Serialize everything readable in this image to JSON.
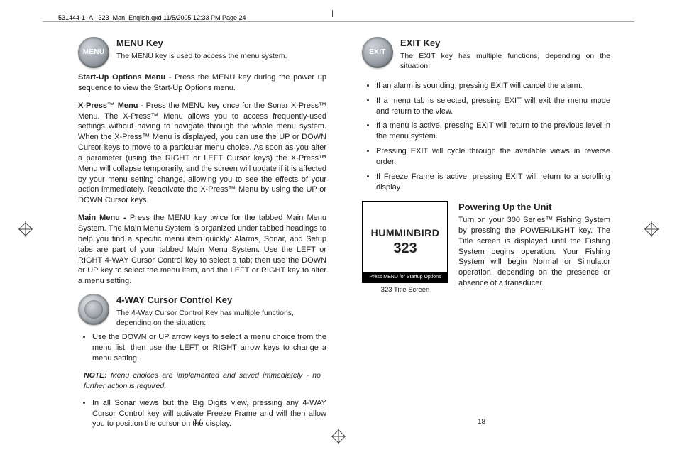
{
  "print_header": "531444-1_A - 323_Man_English.qxd  11/5/2005  12:33 PM  Page 24",
  "left": {
    "menu_key": {
      "icon_label": "MENU",
      "heading": "MENU Key",
      "sub": "The MENU key is used to access the menu system."
    },
    "startup_para_lead": "Start-Up Options Menu",
    "startup_para_rest": " - Press the MENU key during the power up sequence to view the Start-Up Options menu.",
    "xpress_para_lead": "X-Press™ Menu",
    "xpress_para_rest": " -  Press the MENU key once for the Sonar X-Press™ Menu. The X-Press™ Menu allows you to access frequently-used settings without having to navigate through the whole menu system. When the X-Press™ Menu is displayed, you can use the UP or DOWN Cursor keys to move to a particular menu choice. As soon as you alter a parameter (using the RIGHT or LEFT Cursor keys) the X-Press™ Menu will collapse temporarily, and the screen will update if it is affected by your menu setting change, allowing you to see the effects of your action immediately. Reactivate the X-Press™ Menu by using the UP or DOWN Cursor keys.",
    "main_para_lead": "Main Menu - ",
    "main_para_rest": "Press the MENU key twice for the tabbed Main Menu System. The Main Menu System is organized under tabbed headings to help you find a specific menu item quickly: Alarms, Sonar, and Setup tabs are part of your tabbed Main Menu System. Use the LEFT or RIGHT 4-WAY Cursor Control  key to select a tab; then use the DOWN or UP key to select the menu item, and the LEFT or RIGHT key to alter a menu setting.",
    "cursor_key": {
      "heading": "4-WAY Cursor Control Key",
      "sub": "The 4-Way Cursor Control Key has multiple functions, depending on the situation:"
    },
    "cursor_bullets": [
      "Use the DOWN or UP arrow keys to select a menu choice from the menu list, then use the LEFT or RIGHT arrow keys to change a menu setting."
    ],
    "note_lead": "NOTE:",
    "note_rest": " Menu choices are implemented and saved immediately - no further action is required.",
    "cursor_bullets2": [
      "In all Sonar views but the Big Digits view,  pressing any 4-WAY Cursor Control key will activate Freeze Frame and will then allow you to position the cursor on the display."
    ],
    "page_num": "17"
  },
  "right": {
    "exit_key": {
      "icon_label": "EXIT",
      "heading": "EXIT Key",
      "sub": "The EXIT key has multiple functions, depending on the situation:"
    },
    "exit_bullets": [
      "If an alarm is sounding, pressing EXIT will cancel the alarm.",
      "If a menu tab is selected, pressing EXIT will exit the menu mode and return to the view.",
      "If a menu is active, pressing EXIT will return to the previous level in the menu system.",
      "Pressing EXIT will cycle through the available views in reverse order.",
      "If Freeze Frame is active, pressing EXIT will return to a scrolling display."
    ],
    "power": {
      "heading": "Powering Up the Unit",
      "para": "Turn on your 300 Series™ Fishing System by pressing the POWER/LIGHT key. The Title screen is displayed until the Fishing System begins operation. Your Fishing System will begin Normal or Simulator operation, depending on the presence or absence of a transducer."
    },
    "ts": {
      "brand": "HUMMINBIRD",
      "model": "323",
      "bar": "Press MENU for Startup Options",
      "caption": "323 Title Screen"
    },
    "page_num": "18"
  }
}
